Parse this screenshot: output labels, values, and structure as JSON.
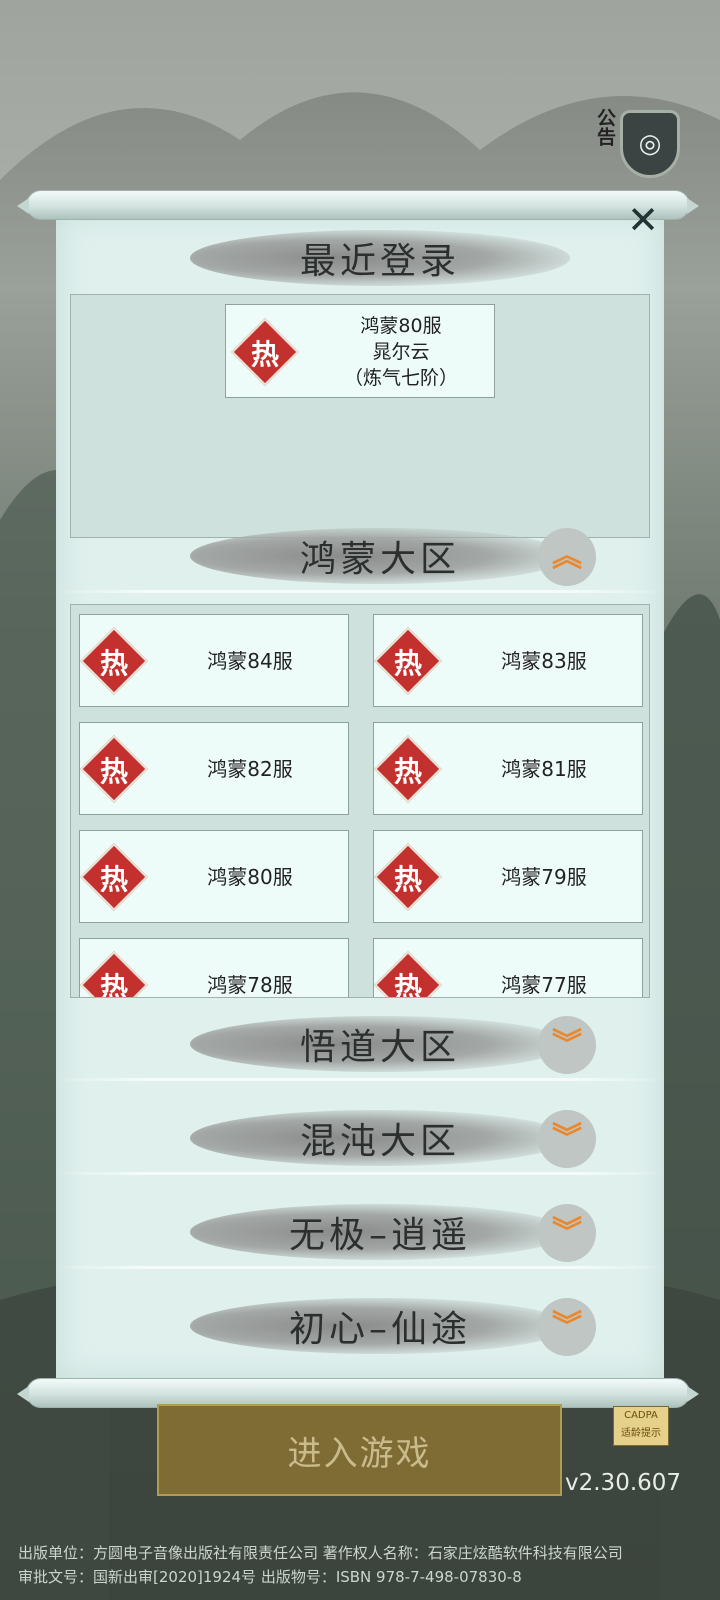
{
  "header": {
    "notice_label": "公告"
  },
  "recent": {
    "title": "最近登录",
    "hot_label": "热",
    "server_name": "鸿蒙80服",
    "character_name": "晁尔云",
    "realm": "（炼气七阶）"
  },
  "regions": [
    {
      "title": "鸿蒙大区",
      "expanded": true
    },
    {
      "title": "悟道大区",
      "expanded": false
    },
    {
      "title": "混沌大区",
      "expanded": false
    },
    {
      "title": "无极–逍遥",
      "expanded": false
    },
    {
      "title": "初心–仙途",
      "expanded": false
    }
  ],
  "servers": [
    {
      "name": "鸿蒙84服",
      "hot": "热"
    },
    {
      "name": "鸿蒙83服",
      "hot": "热"
    },
    {
      "name": "鸿蒙82服",
      "hot": "热"
    },
    {
      "name": "鸿蒙81服",
      "hot": "热"
    },
    {
      "name": "鸿蒙80服",
      "hot": "热"
    },
    {
      "name": "鸿蒙79服",
      "hot": "热"
    },
    {
      "name": "鸿蒙78服",
      "hot": "热"
    },
    {
      "name": "鸿蒙77服",
      "hot": "热"
    }
  ],
  "enter_button": "进入游戏",
  "cadpa": {
    "top": "CADPA",
    "bottom": "适龄提示"
  },
  "version": "v2.30.607",
  "footer": {
    "line1": "出版单位：方圆电子音像出版社有限责任公司    著作权人名称：石家庄炫酷软件科技有限公司",
    "line2": "审批文号：国新出审[2020]1924号          出版物号：ISBN 978-7-498-07830-8"
  },
  "colors": {
    "paper": "#dff0ed",
    "hot_badge": "#c3312e",
    "enter_button": "#7f6b34",
    "chevron": "#e9882f"
  }
}
